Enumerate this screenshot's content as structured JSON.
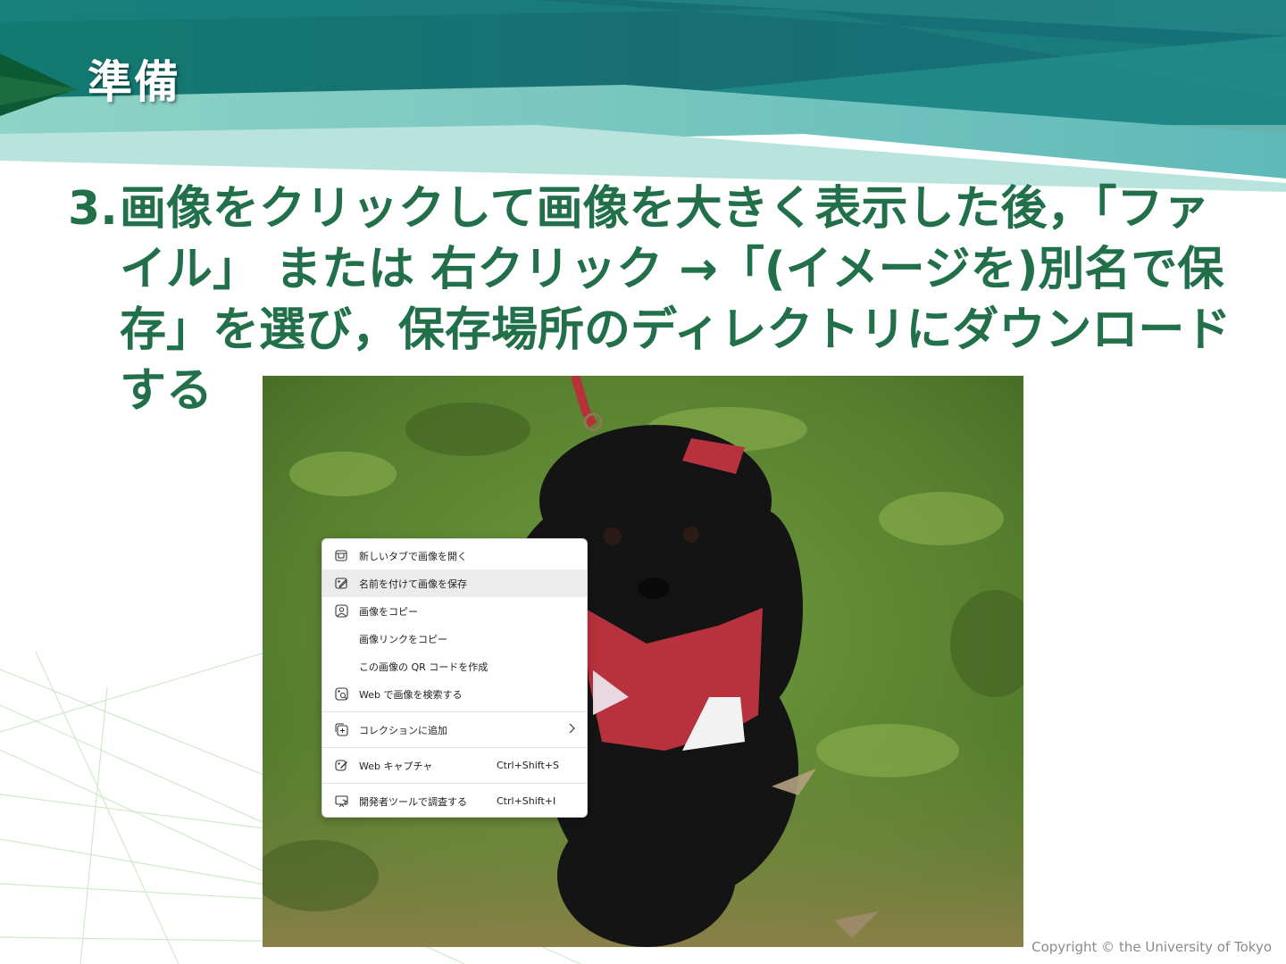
{
  "slide": {
    "title": "準備",
    "step_number": "3.",
    "step_text": "画像をクリックして画像を大きく表示した後，「ファイル」 または 右クリック →「(イメージを)別名で保存」を選び，保存場所のディレクトリにダウンロードする",
    "copyright": "Copyright © the University of Tokyo"
  },
  "context_menu": {
    "items": [
      {
        "label": "新しいタブで画像を開く",
        "icon": "open-in-new-tab-icon",
        "shortcut": ""
      },
      {
        "label": "名前を付けて画像を保存",
        "icon": "save-image-icon",
        "shortcut": "",
        "highlighted": true
      },
      {
        "label": "画像をコピー",
        "icon": "copy-image-icon",
        "shortcut": ""
      },
      {
        "label": "画像リンクをコピー",
        "icon": "",
        "shortcut": ""
      },
      {
        "label": "この画像の QR コードを作成",
        "icon": "",
        "shortcut": ""
      },
      {
        "label": "Web で画像を検索する",
        "icon": "visual-search-icon",
        "shortcut": ""
      },
      {
        "label": "コレクションに追加",
        "icon": "collections-icon",
        "shortcut": "",
        "submenu": true
      },
      {
        "label": "Web キャプチャ",
        "icon": "web-capture-icon",
        "shortcut": "Ctrl+Shift+S"
      },
      {
        "label": "開発者ツールで調査する",
        "icon": "devtools-icon",
        "shortcut": "Ctrl+Shift+I"
      }
    ]
  },
  "colors": {
    "title_text": "#ffffff",
    "step_text": "#22704a",
    "header_teal": "#1a7f80",
    "header_light": "#7cc8c0",
    "menu_highlight": "#ececec"
  }
}
